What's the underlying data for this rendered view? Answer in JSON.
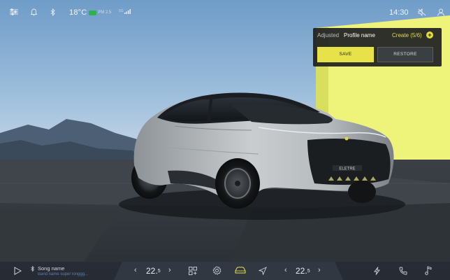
{
  "status_bar": {
    "temperature": "18°C",
    "aqi": "PM 2.5",
    "signal": "5G",
    "time": "14:30"
  },
  "profile_panel": {
    "adjusted_label": "Adjusted",
    "profile_name": "Profile name",
    "create_label": "Create (5/6)",
    "save_label": "SAVE",
    "restore_label": "RESTORE"
  },
  "car": {
    "badge": "ELETRE"
  },
  "dock": {
    "song_name": "Song name",
    "song_artist": "Band name super longgg...",
    "temp_left": "22.",
    "temp_left_decimal": "5",
    "temp_right": "22.",
    "temp_right_decimal": "5"
  },
  "colors": {
    "accent": "#e8e24a",
    "panel": "#1e2022",
    "wall": "#eef37a",
    "sky": "#6f9cc8"
  },
  "icons": [
    "settings-sliders-icon",
    "bell-icon",
    "bluetooth-icon",
    "signal-icon",
    "mute-icon",
    "user-icon",
    "play-icon",
    "bluetooth-small-icon",
    "apps-grid-icon",
    "settings-gear-icon",
    "car-icon",
    "navigation-icon",
    "energy-icon",
    "phone-icon",
    "music-icon"
  ]
}
